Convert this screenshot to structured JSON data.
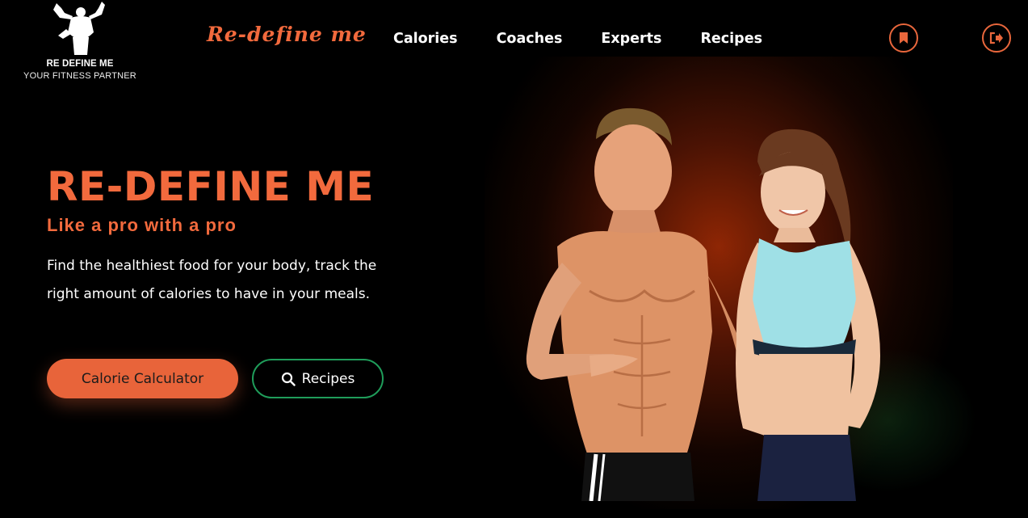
{
  "logo": {
    "title": "RE DEFINE ME",
    "subtitle": "YOUR FITNESS PARTNER"
  },
  "brand": "Re-define me",
  "nav": [
    {
      "label": "Calories"
    },
    {
      "label": "Coaches"
    },
    {
      "label": "Experts"
    },
    {
      "label": "Recipes"
    }
  ],
  "header_icons": {
    "bookmark": "bookmark-icon",
    "logout": "logout-icon"
  },
  "hero": {
    "title": "RE-DEFINE ME",
    "subtitle": "Like a pro with a pro",
    "description": "Find the healthiest food for your body, track the right amount of calories to have in your meals.",
    "primary_button": "Calorie Calculator",
    "secondary_button": "Recipes"
  },
  "colors": {
    "accent": "#e8643a",
    "outline_green": "#1f9d5a",
    "background": "#000000"
  }
}
